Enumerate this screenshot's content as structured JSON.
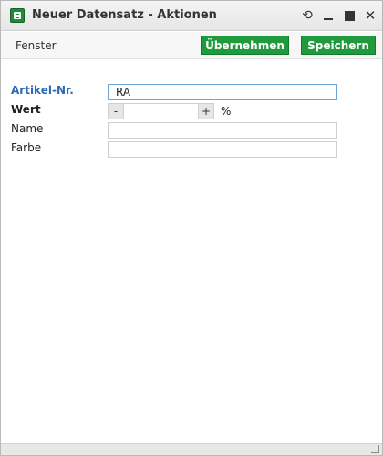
{
  "window": {
    "title": "Neuer Datensatz - Aktionen",
    "controls": {
      "refresh": "⟲",
      "close": "✕"
    }
  },
  "toolbar": {
    "menu_fenster": "Fenster",
    "apply_label": "Übernehmen",
    "save_label": "Speichern"
  },
  "form": {
    "artikel": {
      "label": "Artikel-Nr.",
      "value": "_RA"
    },
    "wert": {
      "label": "Wert",
      "value": "",
      "minus": "-",
      "plus": "+",
      "unit": "%"
    },
    "name": {
      "label": "Name",
      "value": ""
    },
    "farbe": {
      "label": "Farbe",
      "value": ""
    }
  },
  "colors": {
    "accent_green": "#1f9a3c",
    "label_blue": "#2a6bb3",
    "focus_border": "#6fa4d4"
  }
}
